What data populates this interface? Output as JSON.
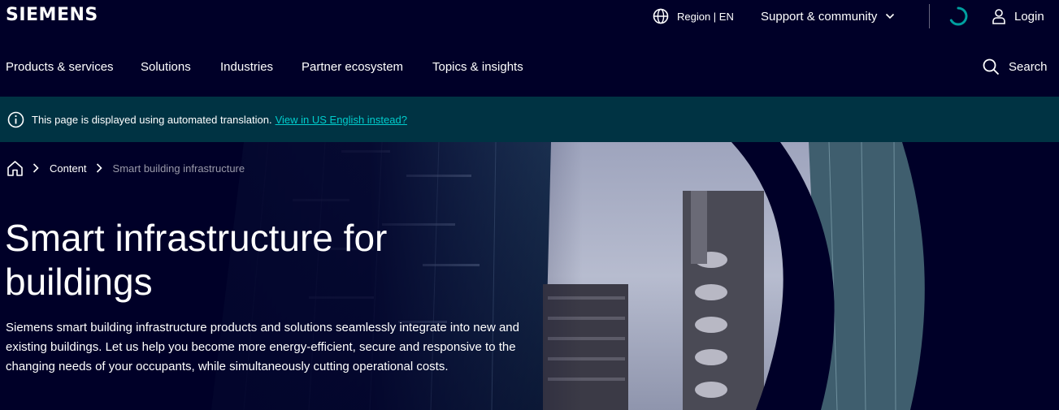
{
  "header": {
    "logo_text": "SIEMENS",
    "region_label": "Region | EN",
    "support_label": "Support & community",
    "login_label": "Login"
  },
  "nav": {
    "items": [
      "Products & services",
      "Solutions",
      "Industries",
      "Partner ecosystem",
      "Topics & insights"
    ],
    "search_label": "Search"
  },
  "notice": {
    "text": "This page is displayed using automated translation.",
    "link_text": "View in US English instead?"
  },
  "breadcrumb": {
    "items": [
      "Content"
    ],
    "current": "Smart building infrastructure"
  },
  "hero": {
    "title": "Smart infrastructure for buildings",
    "description": "Siemens smart building infrastructure products and solutions seamlessly integrate into new and existing buildings. Let us help you become more energy-efficient, secure and responsive to the changing needs of your occupants, while simultaneously cutting operational costs."
  },
  "colors": {
    "background": "#000028",
    "notice_bg": "#003343",
    "link": "#00cccc",
    "spinner": "#00a0a0",
    "muted": "#9999a9"
  },
  "icons": [
    "globe-icon",
    "chevron-down-icon",
    "loading-spinner-icon",
    "user-icon",
    "search-icon",
    "info-icon",
    "home-icon",
    "chevron-right-icon"
  ]
}
